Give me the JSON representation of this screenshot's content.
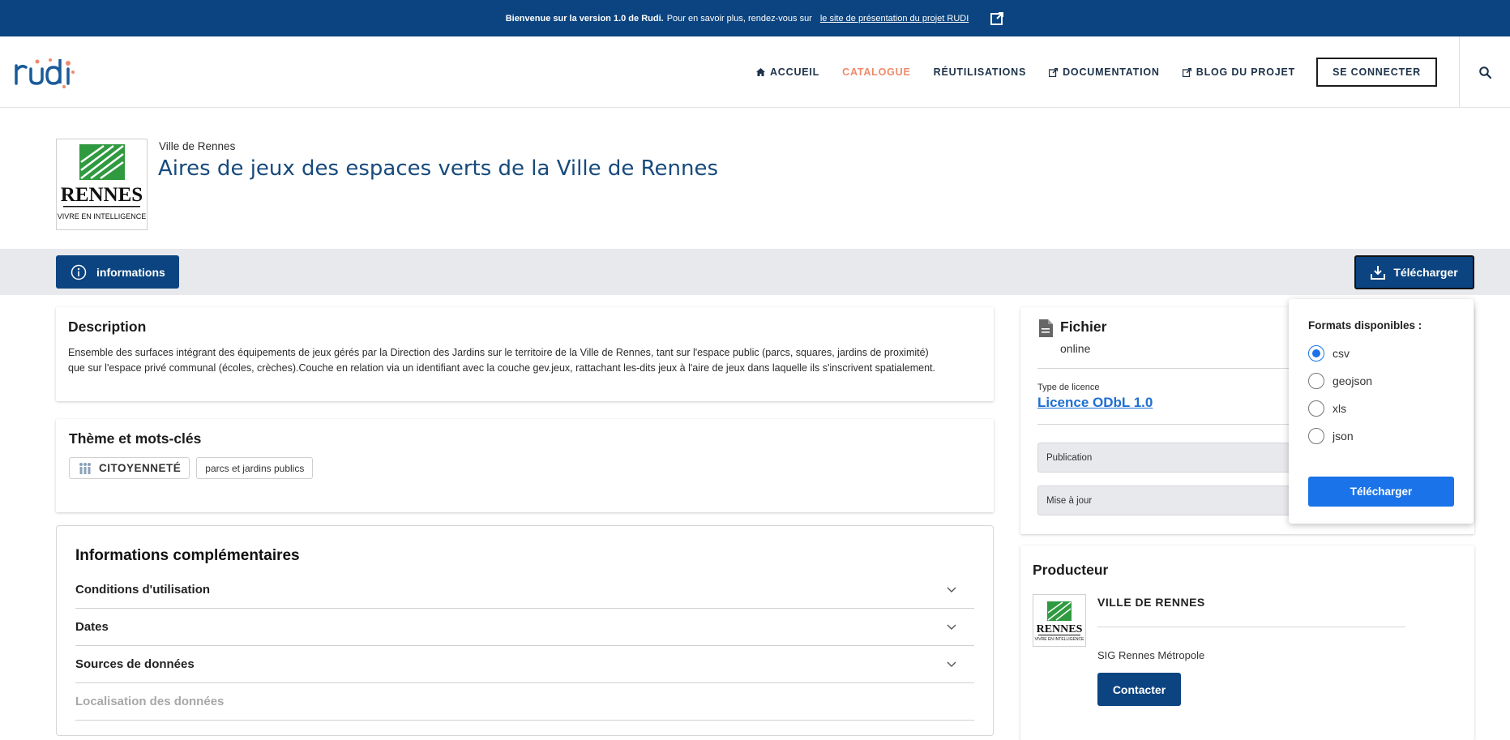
{
  "banner": {
    "bold": "Bienvenue sur la version 1.0 de Rudi.",
    "text": "Pour en savoir plus, rendez-vous sur",
    "link": "le site de présentation du projet RUDI"
  },
  "nav": {
    "items": [
      {
        "label": "ACCUEIL",
        "icon": "home-icon"
      },
      {
        "label": "CATALOGUE"
      },
      {
        "label": "RÉUTILISATIONS"
      },
      {
        "label": "DOCUMENTATION",
        "icon": "external-link-icon"
      },
      {
        "label": "BLOG DU PROJET",
        "icon": "external-link-icon"
      }
    ],
    "login": "SE CONNECTER",
    "active_color": "#ee8a6b"
  },
  "dataset": {
    "organization": "Ville de Rennes",
    "title": "Aires de jeux des espaces verts de la Ville de Rennes"
  },
  "logo": {
    "l1": "RENNES",
    "l2": "VIVRE EN INTELLIGENCE"
  },
  "toolbar": {
    "info_label": "informations",
    "download_label": "Télécharger"
  },
  "description": {
    "heading": "Description",
    "line1": "Ensemble des surfaces intégrant des équipements de jeux gérés par la Direction des Jardins sur le territoire de la Ville de Rennes, tant sur l'espace public (parcs, squares, jardins de proximité)",
    "line2": "que sur l'espace privé communal (écoles, crèches).Couche en relation via un identifiant avec la couche gev.jeux, rattachant les-dits jeux à l'aire de jeux dans laquelle ils s'inscrivent spatialement."
  },
  "theme": {
    "heading": "Thème et mots-clés",
    "tags": [
      "CITOYENNETÉ",
      "parcs et jardins publics"
    ]
  },
  "infos": {
    "heading": "Informations complémentaires",
    "rows": [
      "Conditions d'utilisation",
      "Dates",
      "Sources de données",
      "Localisation des données"
    ]
  },
  "file": {
    "heading": "Fichier",
    "status": "online",
    "licence_label": "Type de licence",
    "licence": "Licence ODbL 1.0",
    "publication": "Publication",
    "update": "Mise à jour"
  },
  "producer": {
    "heading": "Producteur",
    "name": "VILLE DE RENNES",
    "sub": "SIG Rennes Métropole",
    "contact": "Contacter"
  },
  "popup": {
    "heading": "Formats disponibles :",
    "formats": [
      "csv",
      "geojson",
      "xls",
      "json"
    ],
    "selected": "csv",
    "button": "Télécharger"
  }
}
